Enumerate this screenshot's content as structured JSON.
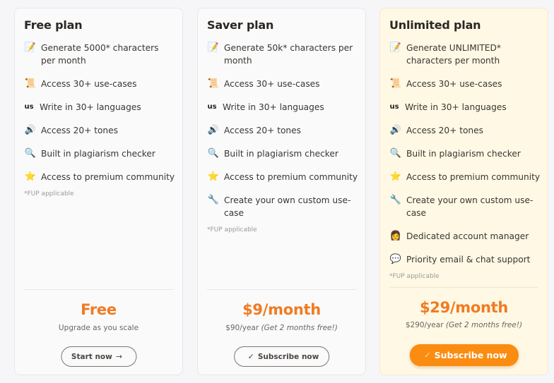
{
  "plans": [
    {
      "title": "Free plan",
      "features": [
        {
          "icon": "memo-icon",
          "glyph": "📝",
          "text": "Generate 5000* characters per month"
        },
        {
          "icon": "scroll-icon",
          "glyph": "📜",
          "text": "Access 30+ use-cases"
        },
        {
          "icon": "us-flag-icon",
          "glyph": "us",
          "text": "Write in 30+ languages"
        },
        {
          "icon": "speaker-icon",
          "glyph": "🔊",
          "text": "Access 20+ tones"
        },
        {
          "icon": "magnifier-icon",
          "glyph": "🔍",
          "text": "Built in plagiarism checker"
        },
        {
          "icon": "star-icon",
          "glyph": "⭐",
          "text": "Access to premium community"
        }
      ],
      "footnote": "*FUP applicable",
      "price": "Free",
      "sub": "Upgrade as you scale",
      "sub_note": "",
      "button": {
        "label": "Start now",
        "icon": "arrow-right-icon",
        "glyph": "→"
      }
    },
    {
      "title": "Saver plan",
      "features": [
        {
          "icon": "memo-icon",
          "glyph": "📝",
          "text": "Generate 50k* characters per month"
        },
        {
          "icon": "scroll-icon",
          "glyph": "📜",
          "text": "Access 30+ use-cases"
        },
        {
          "icon": "us-flag-icon",
          "glyph": "us",
          "text": "Write in 30+ languages"
        },
        {
          "icon": "speaker-icon",
          "glyph": "🔊",
          "text": "Access 20+ tones"
        },
        {
          "icon": "magnifier-icon",
          "glyph": "🔍",
          "text": "Built in plagiarism checker"
        },
        {
          "icon": "star-icon",
          "glyph": "⭐",
          "text": "Access to premium community"
        },
        {
          "icon": "wrench-icon",
          "glyph": "🔧",
          "text": "Create your own custom use-case"
        }
      ],
      "footnote": "*FUP applicable",
      "price": "$9/month",
      "sub": "$90/year",
      "sub_note": "(Get 2 months free!)",
      "button": {
        "label": "Subscribe now",
        "icon": "check-icon",
        "glyph": "✓"
      }
    },
    {
      "title": "Unlimited plan",
      "features": [
        {
          "icon": "memo-icon",
          "glyph": "📝",
          "text": "Generate UNLIMITED* characters per month"
        },
        {
          "icon": "scroll-icon",
          "glyph": "📜",
          "text": "Access 30+ use-cases"
        },
        {
          "icon": "us-flag-icon",
          "glyph": "us",
          "text": "Write in 30+ languages"
        },
        {
          "icon": "speaker-icon",
          "glyph": "🔊",
          "text": "Access 20+ tones"
        },
        {
          "icon": "magnifier-icon",
          "glyph": "🔍",
          "text": "Built in plagiarism checker"
        },
        {
          "icon": "star-icon",
          "glyph": "⭐",
          "text": "Access to premium community"
        },
        {
          "icon": "wrench-icon",
          "glyph": "🔧",
          "text": "Create your own custom use-case"
        },
        {
          "icon": "account-manager-icon",
          "glyph": "👩",
          "text": "Dedicated account manager"
        },
        {
          "icon": "speech-bubble-icon",
          "glyph": "💬",
          "text": "Priority email & chat support"
        }
      ],
      "footnote": "*FUP applicable",
      "price": "$29/month",
      "sub": "$290/year",
      "sub_note": "(Get 2 months free!)",
      "button": {
        "label": "Subscribe now",
        "icon": "check-icon",
        "glyph": "✓"
      }
    }
  ],
  "colors": {
    "accent": "#f07b22",
    "primary_button": "#fb8c12",
    "highlight_card": "#fef8e4"
  }
}
